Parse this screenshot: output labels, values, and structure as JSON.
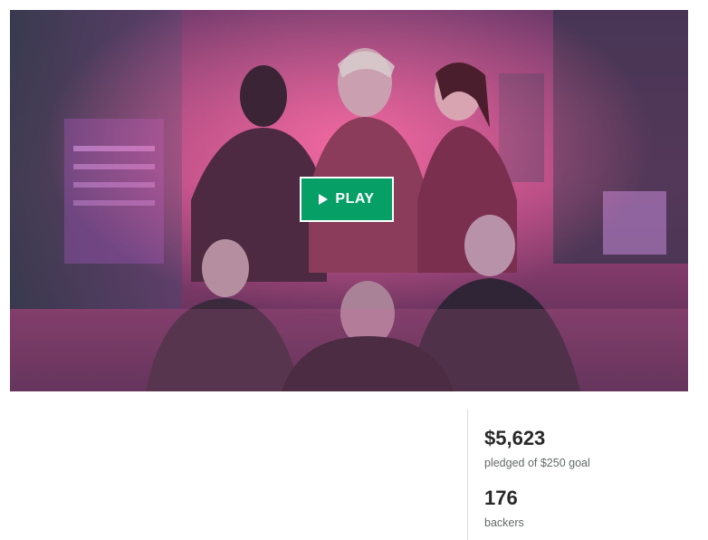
{
  "video": {
    "play_label": "PLAY",
    "play_icon": "play-triangle-icon",
    "button_color": "#069f66"
  },
  "stats": {
    "pledged": {
      "amount": "$5,623",
      "label": "pledged of $250 goal"
    },
    "backers": {
      "count": "176",
      "label": "backers"
    }
  }
}
